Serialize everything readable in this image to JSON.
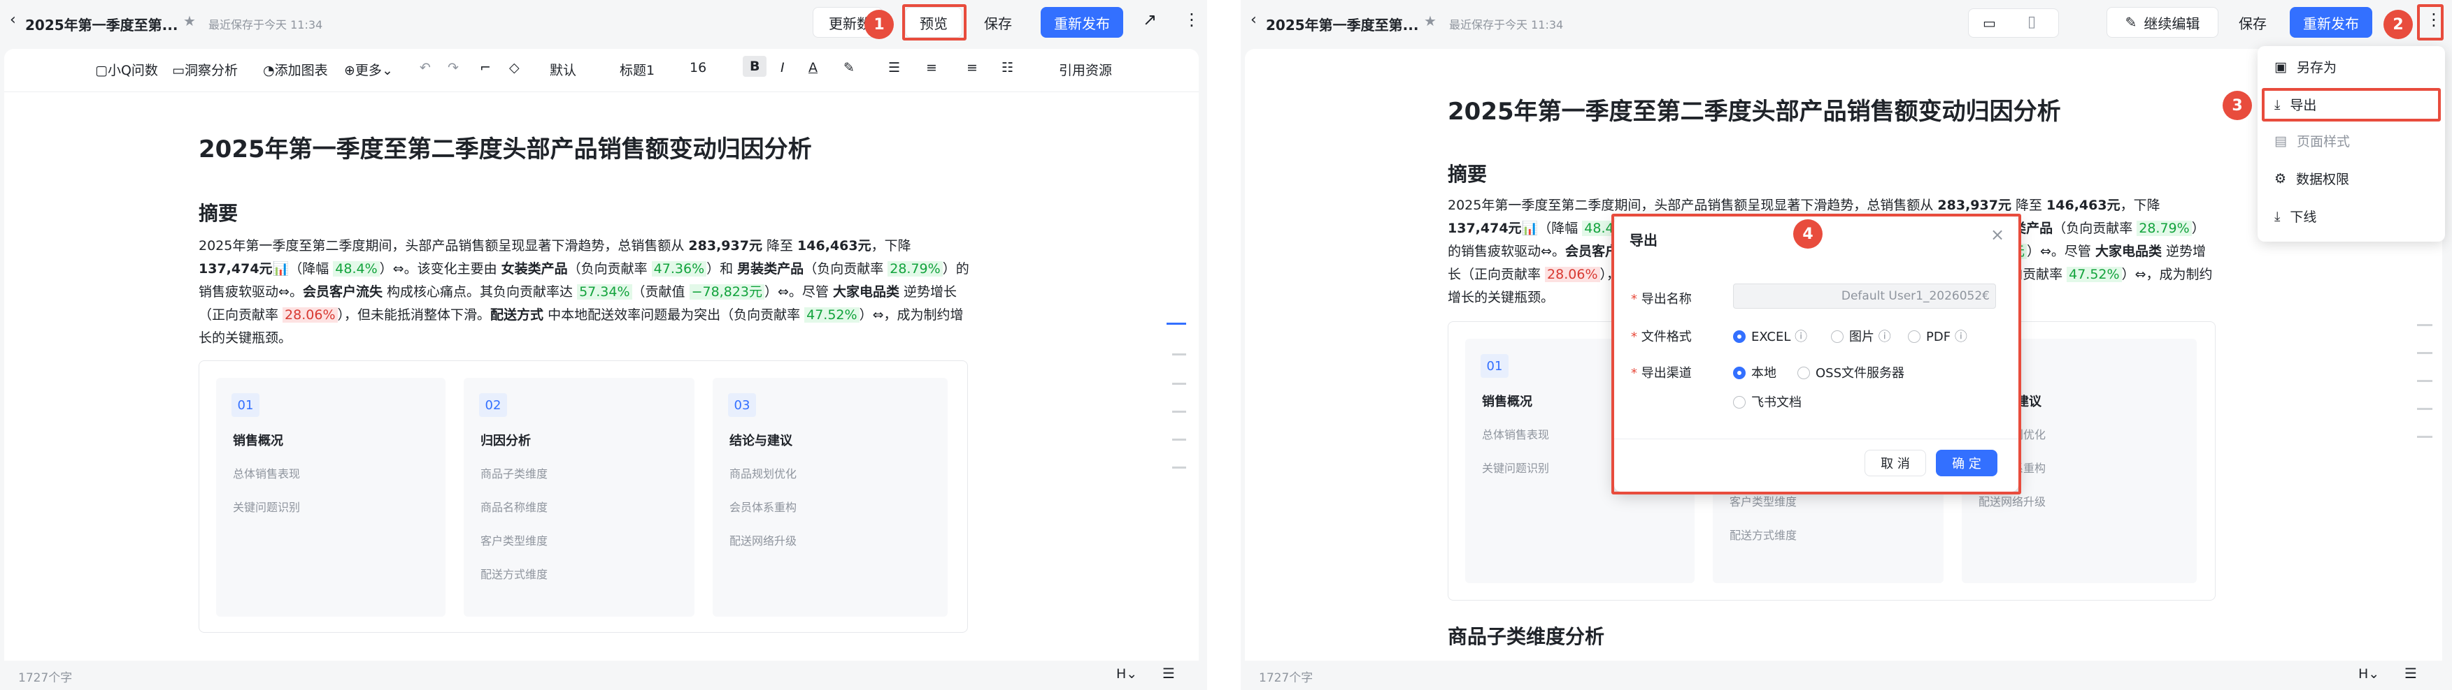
{
  "left": {
    "doc_title": "2025年第一季度至第...",
    "save_status": "最近保存于今天 11:34",
    "update_btn": "更新数",
    "preview_btn": "预览",
    "save_btn": "保存",
    "publish_btn": "重新发布",
    "fmt": {
      "ask": "小Q问数",
      "insight": "洞察分析",
      "add_chart": "添加图表",
      "more": "更多",
      "font": "默认",
      "heading": "标题1",
      "size": "16",
      "cite": "引用资源"
    },
    "step1": "1",
    "word_count": "1727个字"
  },
  "right": {
    "doc_title": "2025年第一季度至第...",
    "save_status": "最近保存于今天 11:34",
    "continue_edit": "继续编辑",
    "save_btn": "保存",
    "publish_btn": "重新发布",
    "step2": "2",
    "step3": "3",
    "step4": "4",
    "menu": {
      "save_as": "另存为",
      "export": "导出",
      "page_style": "页面样式",
      "data_perm": "数据权限",
      "offline": "下线"
    },
    "section_title": "商品子类维度分析",
    "word_count": "1727个字",
    "dialog": {
      "title": "导出",
      "name_label": "导出名称",
      "name_value": "Default User1_2026052€",
      "format_label": "文件格式",
      "fmt_excel": "EXCEL",
      "fmt_pic": "图片",
      "fmt_pdf": "PDF",
      "channel_label": "导出渠道",
      "ch_local": "本地",
      "ch_oss": "OSS文件服务器",
      "ch_feishu": "飞书文档",
      "cancel": "取 消",
      "confirm": "确 定"
    }
  },
  "doc": {
    "title": "2025年第一季度至第二季度头部产品销售额变动归因分析",
    "summary_heading": "摘要",
    "p": {
      "a": "2025年第一季度至第二季度期间，头部产品销售额呈现显著下滑趋势，总销售额从 ",
      "v1": "283,937元",
      "b": " 降至 ",
      "v2": "146,463元",
      "c": "，下降 ",
      "v3": "137,474元",
      "d": "（降幅 ",
      "pct1": "48.4%",
      "e": "）",
      "f": "。该变化主要由 ",
      "k1": "女装类产品",
      "g": "（负向贡献率 ",
      "pct2": "47.36%",
      "h": "）和 ",
      "k2": "男装类产品",
      "i": "（负向贡献率 ",
      "pct3": "28.79%",
      "j": "）的销售疲软驱动",
      "k": "。",
      "k3": "会员客户流失",
      "l": " 构成核心痛点。其负向贡献率达 ",
      "pct4": "57.34%",
      "m": "（贡献值 ",
      "neg": "−78,823元",
      "n": "）",
      "o": "。尽管 ",
      "k4": "大家电品类",
      "q": " 逆势增长（正向贡献率 ",
      "pct5": "28.06%",
      "s": "），但未能抵消整体下滑。",
      "k5": "配送方式",
      "t": " 中本地配送效率问题最为突出（负向贡献率 ",
      "pct6": "47.52%",
      "u": "）",
      "w": "，成为制约增长的关键瓶颈。"
    },
    "cards": [
      {
        "num": "01",
        "title": "销售概况",
        "items": [
          "总体销售表现",
          "关键问题识别"
        ]
      },
      {
        "num": "02",
        "title": "归因分析",
        "items": [
          "商品子类维度",
          "商品名称维度",
          "客户类型维度",
          "配送方式维度"
        ]
      },
      {
        "num": "03",
        "title": "结论与建议",
        "items": [
          "商品规划优化",
          "会员体系重构",
          "配送网络升级"
        ]
      }
    ]
  }
}
